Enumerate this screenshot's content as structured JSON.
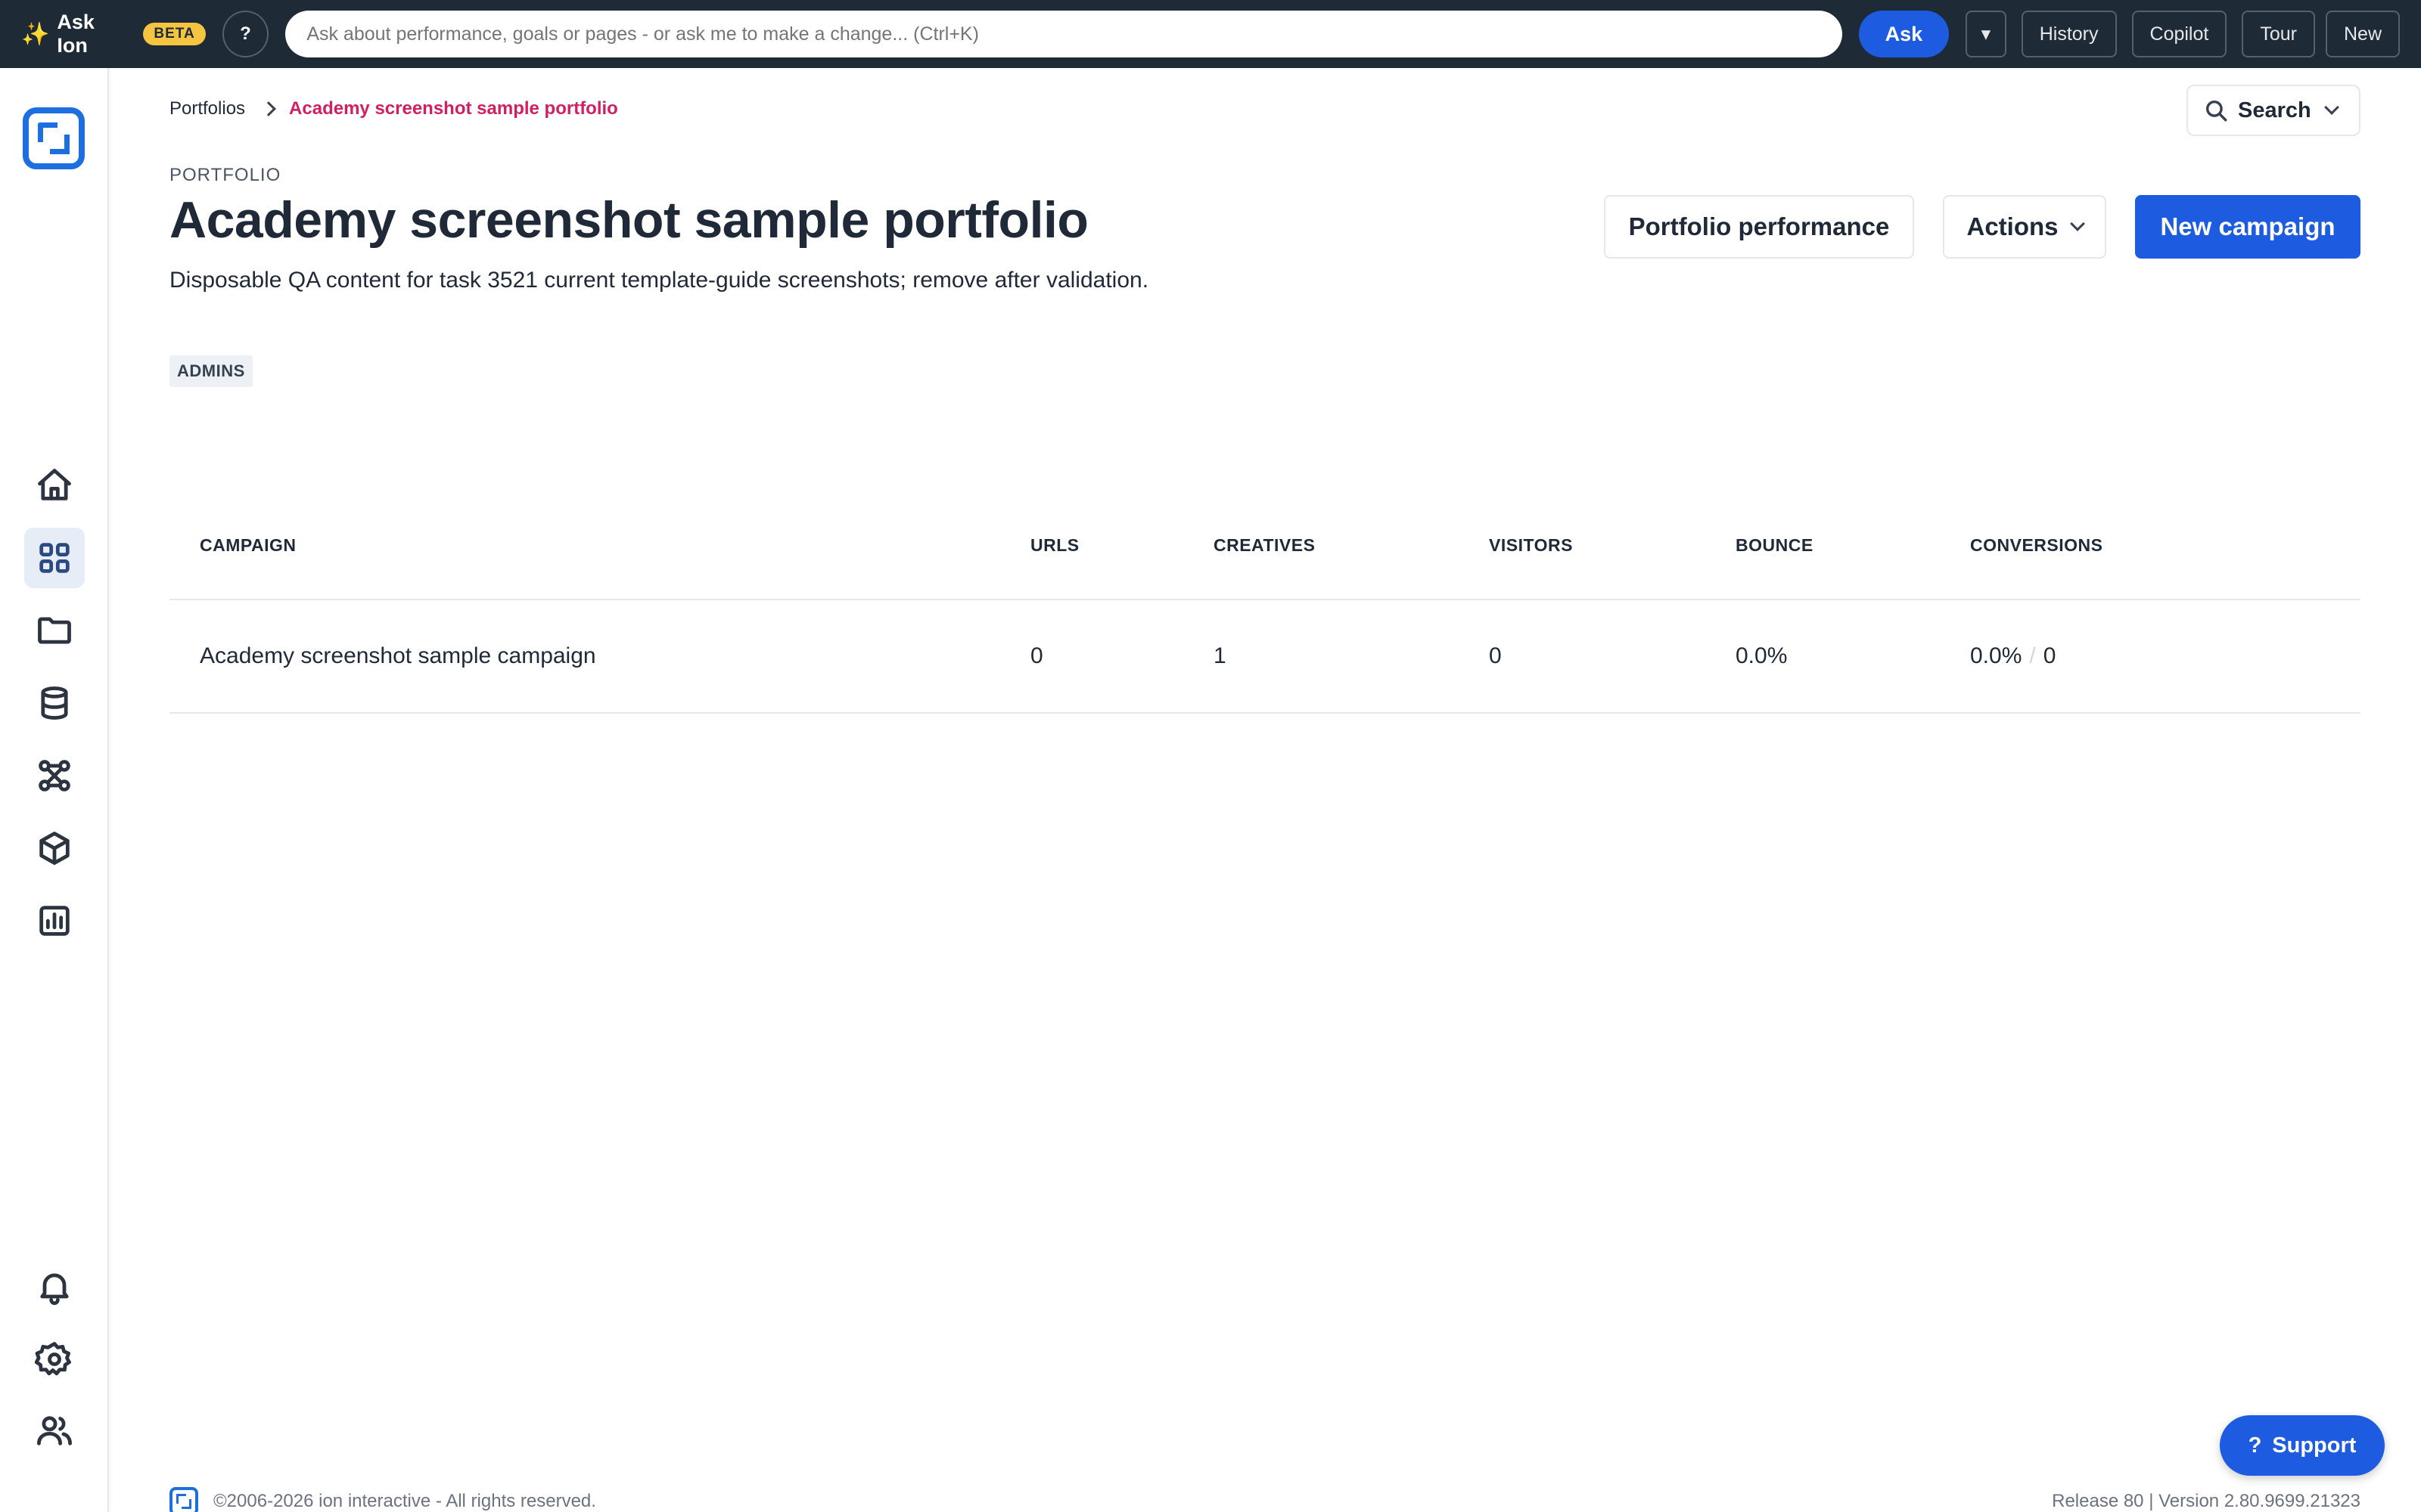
{
  "topbar": {
    "brand_label": "Ask Ion",
    "brand_icon": "sparkle-icon",
    "beta_badge": "BETA",
    "help_label": "?",
    "ask_placeholder": "Ask about performance, goals or pages - or ask me to make a change... (Ctrl+K)",
    "ask_button": "Ask",
    "dropdown_glyph": "▾",
    "history_button": "History",
    "copilot_button": "Copilot",
    "tour_button": "Tour",
    "new_button": "New"
  },
  "sidebar": {
    "items": [
      {
        "icon": "home-icon",
        "active": false
      },
      {
        "icon": "grid-icon",
        "active": true
      },
      {
        "icon": "folder-icon",
        "active": false
      },
      {
        "icon": "database-icon",
        "active": false
      },
      {
        "icon": "integrations-icon",
        "active": false
      },
      {
        "icon": "cube-icon",
        "active": false
      },
      {
        "icon": "chart-icon",
        "active": false
      },
      {
        "icon": "bell-icon",
        "active": false
      },
      {
        "icon": "gear-icon",
        "active": false
      },
      {
        "icon": "users-icon",
        "active": false
      }
    ]
  },
  "breadcrumb": {
    "root": "Portfolios",
    "current": "Academy screenshot sample portfolio"
  },
  "search_dropdown": {
    "label": "Search"
  },
  "page": {
    "eyebrow": "PORTFOLIO",
    "title": "Academy screenshot sample portfolio",
    "description": "Disposable QA content for task 3521 current template-guide screenshots; remove after validation.",
    "tag": "ADMINS"
  },
  "actions": {
    "performance_button": "Portfolio performance",
    "actions_button": "Actions",
    "new_campaign_button": "New campaign"
  },
  "table": {
    "headers": [
      "CAMPAIGN",
      "URLS",
      "CREATIVES",
      "VISITORS",
      "BOUNCE",
      "CONVERSIONS"
    ],
    "rows": [
      {
        "campaign": "Academy screenshot sample campaign",
        "urls": "0",
        "creatives": "1",
        "visitors": "0",
        "bounce": "0.0%",
        "conversion_rate": "0.0%",
        "conversion_sep": "/",
        "conversion_count": "0"
      }
    ]
  },
  "support_button": {
    "icon": "?",
    "label": "Support"
  },
  "footer": {
    "copyright": "©2006-2026 ion interactive - All rights reserved.",
    "version": "Release 80 | Version 2.80.9699.21323"
  },
  "colors": {
    "topbar_bg": "#1e2a36",
    "primary": "#1d5be0",
    "breadcrumb_current": "#d11f63",
    "beta_badge": "#f5c542",
    "logo": "#1d6fe0"
  }
}
